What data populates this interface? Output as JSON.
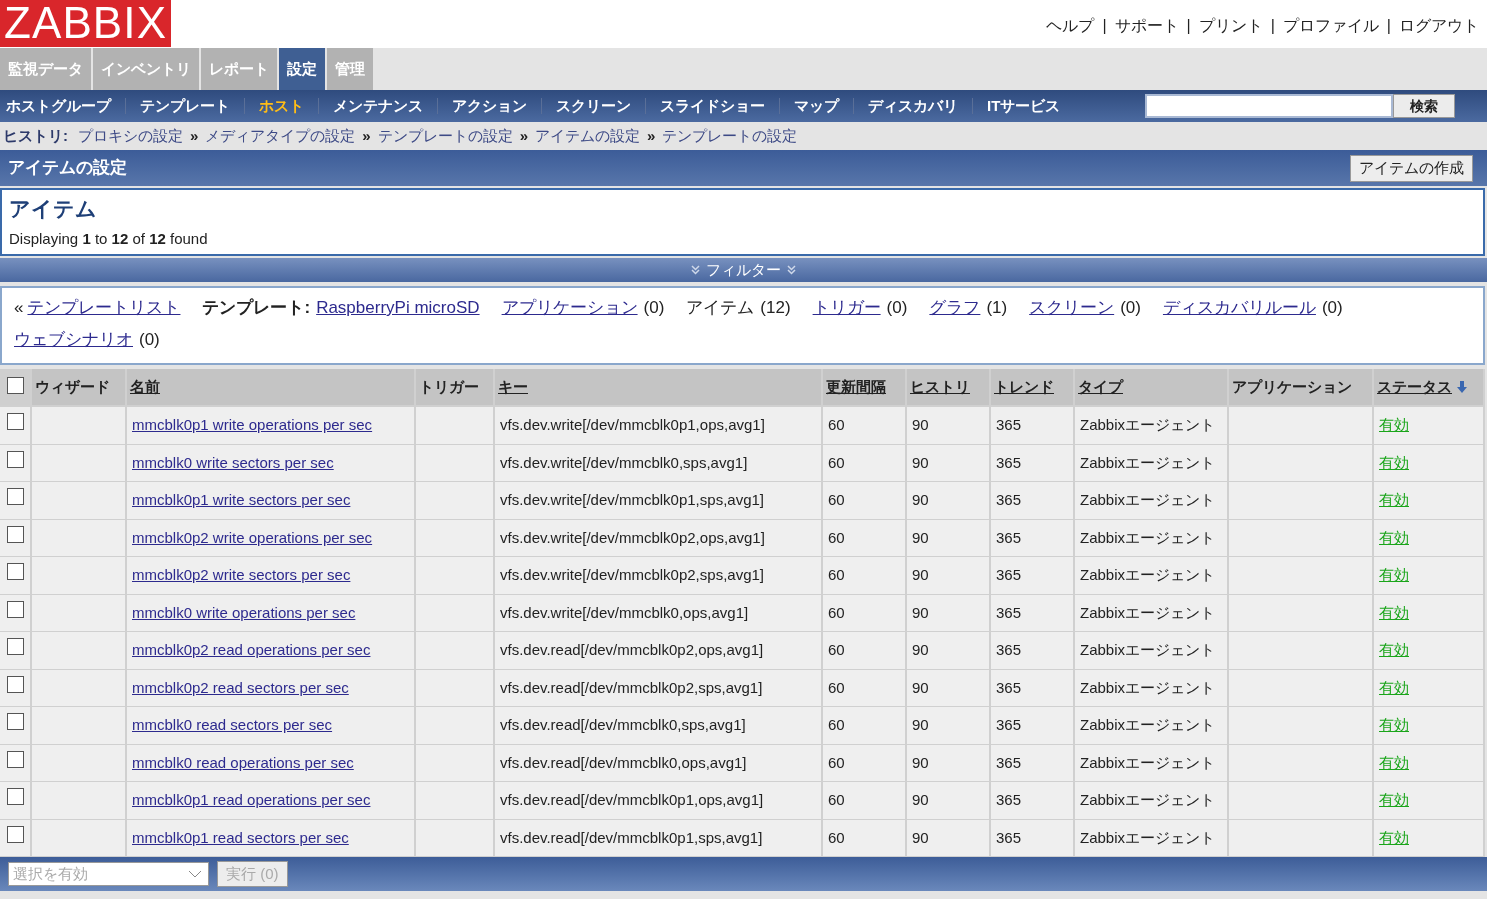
{
  "logo": "ZABBIX",
  "header_links": [
    "ヘルプ",
    "サポート",
    "プリント",
    "プロファイル",
    "ログアウト"
  ],
  "header_separator": "|",
  "main_tabs": [
    {
      "label": "監視データ",
      "selected": false
    },
    {
      "label": "インベントリ",
      "selected": false
    },
    {
      "label": "レポート",
      "selected": false
    },
    {
      "label": "設定",
      "selected": true
    },
    {
      "label": "管理",
      "selected": false
    }
  ],
  "sub_nav": [
    {
      "label": "ホストグループ",
      "selected": false
    },
    {
      "label": "テンプレート",
      "selected": false
    },
    {
      "label": "ホスト",
      "selected": true
    },
    {
      "label": "メンテナンス",
      "selected": false
    },
    {
      "label": "アクション",
      "selected": false
    },
    {
      "label": "スクリーン",
      "selected": false
    },
    {
      "label": "スライドショー",
      "selected": false
    },
    {
      "label": "マップ",
      "selected": false
    },
    {
      "label": "ディスカバリ",
      "selected": false
    },
    {
      "label": "ITサービス",
      "selected": false
    }
  ],
  "search": {
    "button": "検索"
  },
  "history": {
    "label": "ヒストリ:",
    "separator": "»",
    "items": [
      "プロキシの設定",
      "メディアタイプの設定",
      "テンプレートの設定",
      "アイテムの設定",
      "テンプレートの設定"
    ]
  },
  "page_title": "アイテムの設定",
  "create_button": "アイテムの作成",
  "items_box": {
    "heading": "アイテム",
    "summary": "Displaying **1** to **12** of **12** found"
  },
  "filter": {
    "label": "フィルター",
    "expanded": false
  },
  "nav_links": [
    {
      "kind": "back",
      "prefix": "«",
      "label": "テンプレートリスト"
    },
    {
      "kind": "template",
      "prefix": "テンプレート:",
      "label": "RaspberryPi microSD"
    },
    {
      "kind": "count",
      "label": "アプリケーション",
      "count": "(0)",
      "linked": true
    },
    {
      "kind": "count",
      "label": "アイテム",
      "count": "(12)",
      "linked": false
    },
    {
      "kind": "count",
      "label": "トリガー",
      "count": "(0)",
      "linked": true
    },
    {
      "kind": "count",
      "label": "グラフ",
      "count": "(1)",
      "linked": true
    },
    {
      "kind": "count",
      "label": "スクリーン",
      "count": "(0)",
      "linked": true
    },
    {
      "kind": "count",
      "label": "ディスカバリルール",
      "count": "(0)",
      "linked": true
    },
    {
      "kind": "count",
      "label": "ウェブシナリオ",
      "count": "(0)",
      "linked": true
    }
  ],
  "table": {
    "select_all": {
      "checked": false
    },
    "columns": [
      {
        "label": "ウィザード",
        "sortable": false,
        "sorted": false
      },
      {
        "label": "名前",
        "sortable": true,
        "sorted": false
      },
      {
        "label": "トリガー",
        "sortable": false,
        "sorted": false
      },
      {
        "label": "キー",
        "sortable": true,
        "sorted": false
      },
      {
        "label": "更新間隔",
        "sortable": true,
        "sorted": false
      },
      {
        "label": "ヒストリ",
        "sortable": true,
        "sorted": false
      },
      {
        "label": "トレンド",
        "sortable": true,
        "sorted": false
      },
      {
        "label": "タイプ",
        "sortable": true,
        "sorted": false
      },
      {
        "label": "アプリケーション",
        "sortable": false,
        "sorted": false
      },
      {
        "label": "ステータス",
        "sortable": true,
        "sorted": true
      }
    ],
    "rows": [
      {
        "checked": false,
        "name": "mmcblk0p1 write operations per sec",
        "key": "vfs.dev.write[/dev/mmcblk0p1,ops,avg1]",
        "interval": "60",
        "history": "90",
        "trend": "365",
        "type": "Zabbixエージェント",
        "status": "有効",
        "enabled": true
      },
      {
        "checked": false,
        "name": "mmcblk0 write sectors per sec",
        "key": "vfs.dev.write[/dev/mmcblk0,sps,avg1]",
        "interval": "60",
        "history": "90",
        "trend": "365",
        "type": "Zabbixエージェント",
        "status": "有効",
        "enabled": true
      },
      {
        "checked": false,
        "name": "mmcblk0p1 write sectors per sec",
        "key": "vfs.dev.write[/dev/mmcblk0p1,sps,avg1]",
        "interval": "60",
        "history": "90",
        "trend": "365",
        "type": "Zabbixエージェント",
        "status": "有効",
        "enabled": true
      },
      {
        "checked": false,
        "name": "mmcblk0p2 write operations per sec",
        "key": "vfs.dev.write[/dev/mmcblk0p2,ops,avg1]",
        "interval": "60",
        "history": "90",
        "trend": "365",
        "type": "Zabbixエージェント",
        "status": "有効",
        "enabled": true
      },
      {
        "checked": false,
        "name": "mmcblk0p2 write sectors per sec",
        "key": "vfs.dev.write[/dev/mmcblk0p2,sps,avg1]",
        "interval": "60",
        "history": "90",
        "trend": "365",
        "type": "Zabbixエージェント",
        "status": "有効",
        "enabled": true
      },
      {
        "checked": false,
        "name": "mmcblk0 write operations per sec",
        "key": "vfs.dev.write[/dev/mmcblk0,ops,avg1]",
        "interval": "60",
        "history": "90",
        "trend": "365",
        "type": "Zabbixエージェント",
        "status": "有効",
        "enabled": true
      },
      {
        "checked": false,
        "name": "mmcblk0p2 read operations per sec",
        "key": "vfs.dev.read[/dev/mmcblk0p2,ops,avg1]",
        "interval": "60",
        "history": "90",
        "trend": "365",
        "type": "Zabbixエージェント",
        "status": "有効",
        "enabled": true
      },
      {
        "checked": false,
        "name": "mmcblk0p2 read sectors per sec",
        "key": "vfs.dev.read[/dev/mmcblk0p2,sps,avg1]",
        "interval": "60",
        "history": "90",
        "trend": "365",
        "type": "Zabbixエージェント",
        "status": "有効",
        "enabled": true
      },
      {
        "checked": false,
        "name": "mmcblk0 read sectors per sec",
        "key": "vfs.dev.read[/dev/mmcblk0,sps,avg1]",
        "interval": "60",
        "history": "90",
        "trend": "365",
        "type": "Zabbixエージェント",
        "status": "有効",
        "enabled": true
      },
      {
        "checked": false,
        "name": "mmcblk0 read operations per sec",
        "key": "vfs.dev.read[/dev/mmcblk0,ops,avg1]",
        "interval": "60",
        "history": "90",
        "trend": "365",
        "type": "Zabbixエージェント",
        "status": "有効",
        "enabled": true
      },
      {
        "checked": false,
        "name": "mmcblk0p1 read operations per sec",
        "key": "vfs.dev.read[/dev/mmcblk0p1,ops,avg1]",
        "interval": "60",
        "history": "90",
        "trend": "365",
        "type": "Zabbixエージェント",
        "status": "有効",
        "enabled": true
      },
      {
        "checked": false,
        "name": "mmcblk0p1 read sectors per sec",
        "key": "vfs.dev.read[/dev/mmcblk0p1,sps,avg1]",
        "interval": "60",
        "history": "90",
        "trend": "365",
        "type": "Zabbixエージェント",
        "status": "有効",
        "enabled": true
      }
    ]
  },
  "footer": {
    "action_select": {
      "value": "選択を有効"
    },
    "apply_button": {
      "label": "実行 (0)",
      "disabled": true
    }
  }
}
